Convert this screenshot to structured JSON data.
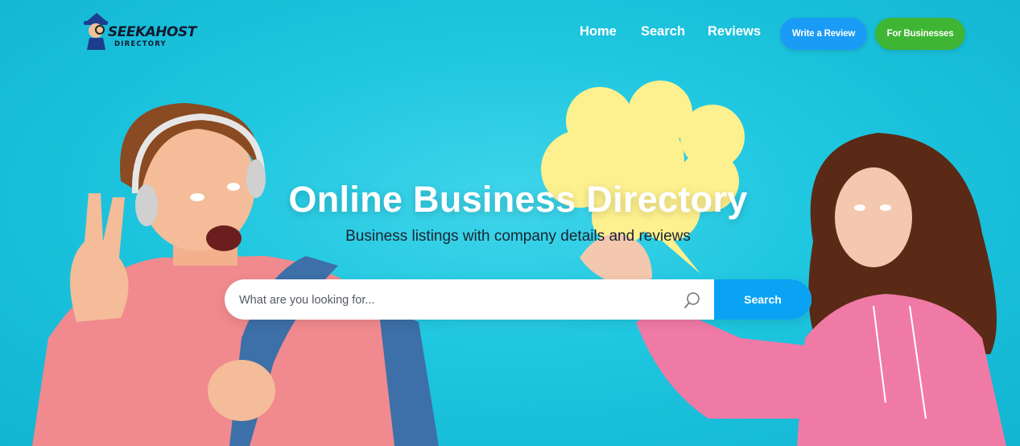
{
  "header": {
    "logo_text": "SEEKAHOST",
    "logo_subtext": "DIRECTORY",
    "nav": [
      {
        "label": "Home"
      },
      {
        "label": "Search"
      },
      {
        "label": "Reviews"
      }
    ],
    "write_review_label": "Write a Review",
    "for_businesses_label": "For Businesses"
  },
  "hero": {
    "title": "Online Business Directory",
    "subtitle": "Business listings with company details and reviews",
    "background_color": "#1ec6df"
  },
  "search": {
    "placeholder": "What are you looking for...",
    "value": "",
    "button_label": "Search",
    "icon": "search-icon"
  },
  "colors": {
    "write_review_button": "#1a9bf5",
    "for_businesses_button": "#3fb534",
    "search_button": "#0aa3f3",
    "speech_bubble": "#fdf08e"
  }
}
